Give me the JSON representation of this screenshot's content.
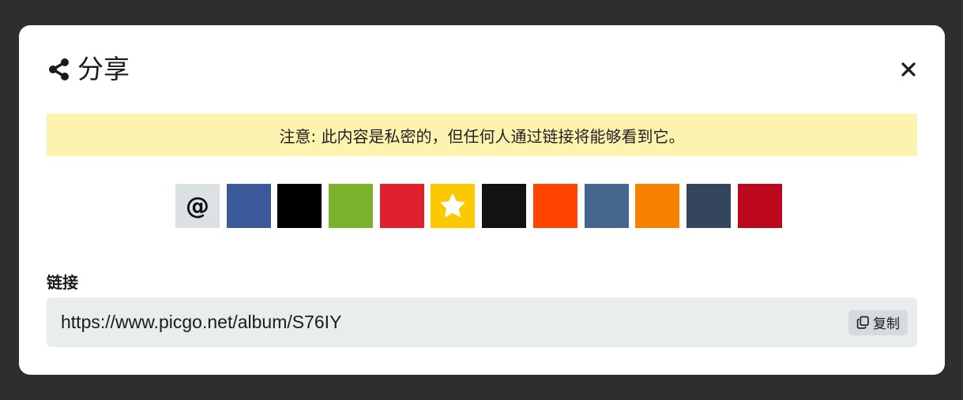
{
  "dialog": {
    "title": "分享",
    "notice": "注意: 此内容是私密的，但任何人通过链接将能够看到它。"
  },
  "share_buttons": [
    {
      "name": "email",
      "label": "@",
      "color": "#dce1e3"
    },
    {
      "name": "facebook",
      "color": "#3b5998"
    },
    {
      "name": "x",
      "color": "#000000"
    },
    {
      "name": "green",
      "color": "#7cb32e"
    },
    {
      "name": "red",
      "color": "#e0202d"
    },
    {
      "name": "star",
      "color": "#fcc800"
    },
    {
      "name": "black",
      "color": "#121214"
    },
    {
      "name": "reddit",
      "color": "#ff4500"
    },
    {
      "name": "vk",
      "color": "#45668e"
    },
    {
      "name": "orange",
      "color": "#f78100"
    },
    {
      "name": "slate",
      "color": "#35465c"
    },
    {
      "name": "crimson",
      "color": "#bd081c"
    }
  ],
  "link": {
    "label": "链接",
    "value": "https://www.picgo.net/album/S76IY",
    "copy_label": "复制"
  }
}
